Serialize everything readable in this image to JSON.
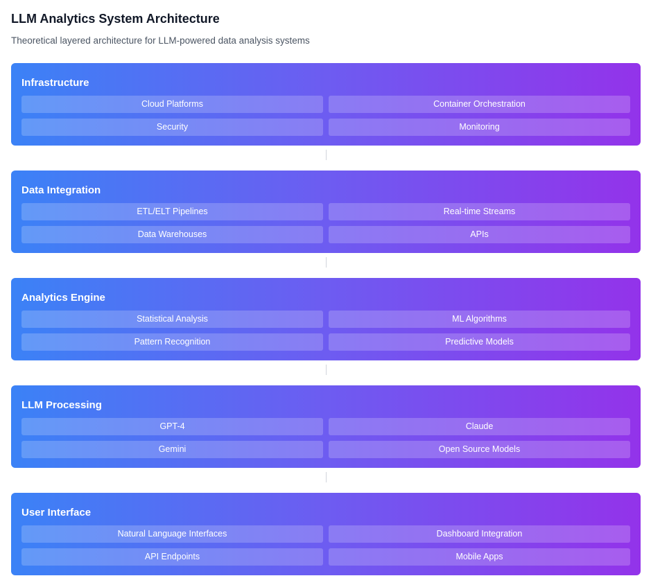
{
  "header": {
    "title": "LLM Analytics System Architecture",
    "subtitle": "Theoretical layered architecture for LLM-powered data analysis systems"
  },
  "layers": [
    {
      "title": "Infrastructure",
      "items": [
        "Cloud Platforms",
        "Container Orchestration",
        "Security",
        "Monitoring"
      ]
    },
    {
      "title": "Data Integration",
      "items": [
        "ETL/ELT Pipelines",
        "Real-time Streams",
        "Data Warehouses",
        "APIs"
      ]
    },
    {
      "title": "Analytics Engine",
      "items": [
        "Statistical Analysis",
        "ML Algorithms",
        "Pattern Recognition",
        "Predictive Models"
      ]
    },
    {
      "title": "LLM Processing",
      "items": [
        "GPT-4",
        "Claude",
        "Gemini",
        "Open Source Models"
      ]
    },
    {
      "title": "User Interface",
      "items": [
        "Natural Language Interfaces",
        "Dashboard Integration",
        "API Endpoints",
        "Mobile Apps"
      ]
    }
  ],
  "colors": {
    "gradient_start": "#3b82f6",
    "gradient_mid": "#6d5cf1",
    "gradient_end": "#9333ea",
    "connector": "#d1d5db"
  }
}
